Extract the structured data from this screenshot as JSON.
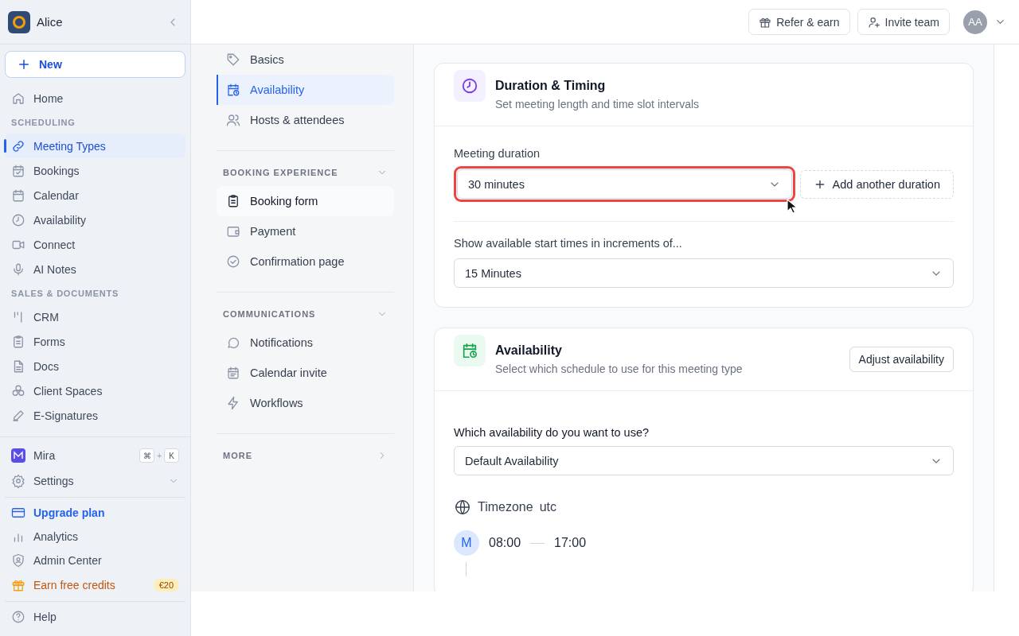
{
  "sidebar": {
    "workspace": "Alice",
    "new_button": "New",
    "nav": [
      {
        "kind": "link",
        "label": "Home",
        "selected": false
      },
      {
        "kind": "heading",
        "label": "SCHEDULING"
      },
      {
        "kind": "link",
        "label": "Meeting Types",
        "selected": true
      },
      {
        "kind": "link",
        "label": "Bookings",
        "selected": false
      },
      {
        "kind": "link",
        "label": "Calendar",
        "selected": false
      },
      {
        "kind": "link",
        "label": "Availability",
        "selected": false
      },
      {
        "kind": "link",
        "label": "Connect",
        "selected": false
      },
      {
        "kind": "link",
        "label": "AI Notes",
        "selected": false
      },
      {
        "kind": "heading",
        "label": "SALES & DOCUMENTS"
      },
      {
        "kind": "link",
        "label": "CRM",
        "selected": false
      },
      {
        "kind": "link",
        "label": "Forms",
        "selected": false
      },
      {
        "kind": "link",
        "label": "Docs",
        "selected": false
      },
      {
        "kind": "link",
        "label": "Client Spaces",
        "selected": false
      },
      {
        "kind": "link",
        "label": "E-Signatures",
        "selected": false
      }
    ],
    "footer_groups": [
      [
        {
          "kind": "assistant",
          "label": "Mira",
          "shortcut": {
            "keys": [
              "⌘",
              "K"
            ],
            "joiner": "+"
          }
        },
        {
          "kind": "menu",
          "label": "Settings",
          "expanded": false
        }
      ],
      [
        {
          "kind": "upgrade",
          "label": "Upgrade plan"
        },
        {
          "kind": "link",
          "label": "Analytics"
        },
        {
          "kind": "link",
          "label": "Admin Center"
        },
        {
          "kind": "promo",
          "label": "Earn free credits",
          "badge": "€20"
        }
      ],
      [
        {
          "kind": "link",
          "label": "Help"
        }
      ]
    ]
  },
  "top_bar": {
    "buttons": [
      {
        "label": "Refer & earn"
      },
      {
        "label": "Invite team"
      }
    ],
    "avatar": "AA"
  },
  "sub_nav": {
    "groups": [
      {
        "items": [
          {
            "label": "Basics",
            "selected": false,
            "hovered": false
          },
          {
            "label": "Availability",
            "selected": true,
            "hovered": false
          },
          {
            "label": "Hosts & attendees",
            "selected": false,
            "hovered": false
          }
        ]
      },
      {
        "title": "BOOKING EXPERIENCE",
        "expanded": true,
        "items": [
          {
            "label": "Booking form",
            "selected": false,
            "hovered": true
          },
          {
            "label": "Payment",
            "selected": false,
            "hovered": false
          },
          {
            "label": "Confirmation page",
            "selected": false,
            "hovered": false
          }
        ]
      },
      {
        "title": "COMMUNICATIONS",
        "expanded": true,
        "items": [
          {
            "label": "Notifications",
            "selected": false,
            "hovered": false
          },
          {
            "label": "Calendar invite",
            "selected": false,
            "hovered": false
          },
          {
            "label": "Workflows",
            "selected": false,
            "hovered": false
          }
        ]
      },
      {
        "title": "MORE",
        "expanded": false
      }
    ]
  },
  "duration_card": {
    "title": "Duration & Timing",
    "subtitle": "Set meeting length and time slot intervals",
    "duration": {
      "label": "Meeting duration",
      "value": "30 minutes",
      "highlighted": true
    },
    "add_button": "Add another duration",
    "increments": {
      "label": "Show available start times in increments of...",
      "value": "15 Minutes"
    }
  },
  "availability_card": {
    "title": "Availability",
    "subtitle": "Select which schedule to use for this meeting type",
    "action": "Adjust availability",
    "schedule": {
      "label": "Which availability do you want to use?",
      "value": "Default Availability"
    },
    "timezone": {
      "label": "Timezone",
      "value": "utc"
    },
    "days": [
      {
        "day": "M",
        "start": "08:00",
        "end": "17:00"
      }
    ]
  }
}
